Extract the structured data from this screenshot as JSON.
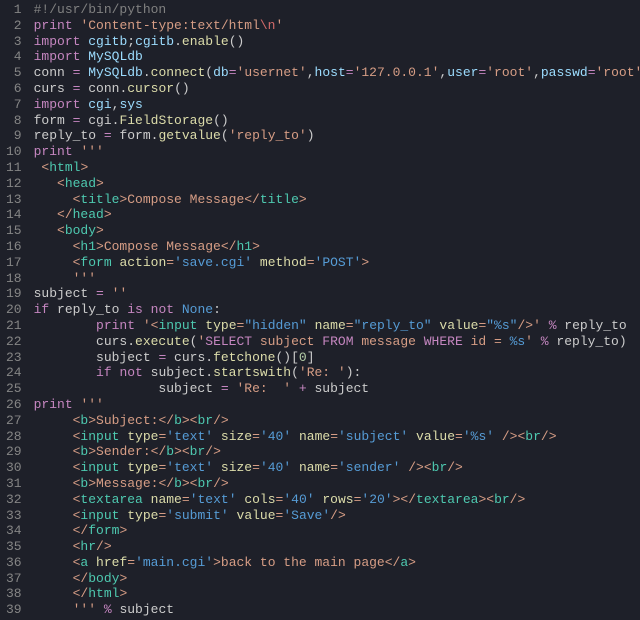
{
  "lines": [
    {
      "n": 1,
      "seg": [
        [
          "#!/usr/bin/python",
          "c-comment"
        ]
      ]
    },
    {
      "n": 2,
      "seg": [
        [
          "print",
          "c-keyword"
        ],
        [
          " ",
          "c-default"
        ],
        [
          "'Content-type:text/html",
          "c-string"
        ],
        [
          "\\n",
          "c-red"
        ],
        [
          "'",
          "c-string"
        ]
      ]
    },
    {
      "n": 3,
      "seg": [
        [
          "import",
          "c-keyword"
        ],
        [
          " ",
          "c-default"
        ],
        [
          "cgitb",
          "c-member"
        ],
        [
          ";",
          "c-default"
        ],
        [
          "cgitb",
          "c-member"
        ],
        [
          ".",
          "c-default"
        ],
        [
          "enable",
          "c-func"
        ],
        [
          "()",
          "c-default"
        ]
      ]
    },
    {
      "n": 4,
      "seg": [
        [
          "import",
          "c-keyword"
        ],
        [
          " ",
          "c-default"
        ],
        [
          "MySQLdb",
          "c-member"
        ]
      ]
    },
    {
      "n": 5,
      "seg": [
        [
          "conn ",
          "c-default"
        ],
        [
          "=",
          "c-keyword"
        ],
        [
          " ",
          "c-default"
        ],
        [
          "MySQLdb",
          "c-member"
        ],
        [
          ".",
          "c-default"
        ],
        [
          "connect",
          "c-func"
        ],
        [
          "(",
          "c-default"
        ],
        [
          "db",
          "c-member"
        ],
        [
          "=",
          "c-keyword"
        ],
        [
          "'usernet'",
          "c-string"
        ],
        [
          ",",
          "c-default"
        ],
        [
          "host",
          "c-member"
        ],
        [
          "=",
          "c-keyword"
        ],
        [
          "'127.0.0.1'",
          "c-string"
        ],
        [
          ",",
          "c-default"
        ],
        [
          "user",
          "c-member"
        ],
        [
          "=",
          "c-keyword"
        ],
        [
          "'root'",
          "c-string"
        ],
        [
          ",",
          "c-default"
        ],
        [
          "passwd",
          "c-member"
        ],
        [
          "=",
          "c-keyword"
        ],
        [
          "'root'",
          "c-string"
        ],
        [
          ")",
          "c-default"
        ]
      ]
    },
    {
      "n": 6,
      "seg": [
        [
          "curs ",
          "c-default"
        ],
        [
          "=",
          "c-keyword"
        ],
        [
          " conn.",
          "c-default"
        ],
        [
          "cursor",
          "c-func"
        ],
        [
          "()",
          "c-default"
        ]
      ]
    },
    {
      "n": 7,
      "seg": [
        [
          "import",
          "c-keyword"
        ],
        [
          " ",
          "c-default"
        ],
        [
          "cgi",
          "c-member"
        ],
        [
          ",",
          "c-default"
        ],
        [
          "sys",
          "c-member"
        ]
      ]
    },
    {
      "n": 8,
      "seg": [
        [
          "form ",
          "c-default"
        ],
        [
          "=",
          "c-keyword"
        ],
        [
          " cgi.",
          "c-default"
        ],
        [
          "FieldStorage",
          "c-func"
        ],
        [
          "()",
          "c-default"
        ]
      ]
    },
    {
      "n": 9,
      "seg": [
        [
          "reply_to ",
          "c-default"
        ],
        [
          "=",
          "c-keyword"
        ],
        [
          " form.",
          "c-default"
        ],
        [
          "getvalue",
          "c-func"
        ],
        [
          "(",
          "c-default"
        ],
        [
          "'reply_to'",
          "c-string"
        ],
        [
          ")",
          "c-default"
        ]
      ]
    },
    {
      "n": 10,
      "seg": [
        [
          "print",
          "c-keyword"
        ],
        [
          " ",
          "c-default"
        ],
        [
          "'''",
          "c-string"
        ]
      ]
    },
    {
      "n": 11,
      "seg": [
        [
          " <",
          "c-string"
        ],
        [
          "html",
          "c-tag"
        ],
        [
          ">",
          "c-string"
        ]
      ]
    },
    {
      "n": 12,
      "seg": [
        [
          "   <",
          "c-string"
        ],
        [
          "head",
          "c-tag"
        ],
        [
          ">",
          "c-string"
        ]
      ]
    },
    {
      "n": 13,
      "seg": [
        [
          "     <",
          "c-string"
        ],
        [
          "title",
          "c-tag"
        ],
        [
          ">Compose Message</",
          "c-string"
        ],
        [
          "title",
          "c-tag"
        ],
        [
          ">",
          "c-string"
        ]
      ]
    },
    {
      "n": 14,
      "seg": [
        [
          "   </",
          "c-string"
        ],
        [
          "head",
          "c-tag"
        ],
        [
          ">",
          "c-string"
        ]
      ]
    },
    {
      "n": 15,
      "seg": [
        [
          "   <",
          "c-string"
        ],
        [
          "body",
          "c-tag"
        ],
        [
          ">",
          "c-string"
        ]
      ]
    },
    {
      "n": 16,
      "seg": [
        [
          "     <",
          "c-string"
        ],
        [
          "h1",
          "c-tag"
        ],
        [
          ">Compose Message</",
          "c-string"
        ],
        [
          "h1",
          "c-tag"
        ],
        [
          ">",
          "c-string"
        ]
      ]
    },
    {
      "n": 17,
      "seg": [
        [
          "     <",
          "c-string"
        ],
        [
          "form",
          "c-tag"
        ],
        [
          " ",
          "c-string"
        ],
        [
          "action",
          "c-builtin"
        ],
        [
          "=",
          "c-string"
        ],
        [
          "'save.cgi'",
          "c-blue"
        ],
        [
          " ",
          "c-string"
        ],
        [
          "method",
          "c-builtin"
        ],
        [
          "=",
          "c-string"
        ],
        [
          "'POST'",
          "c-blue"
        ],
        [
          ">",
          "c-string"
        ]
      ]
    },
    {
      "n": 18,
      "seg": [
        [
          "     '''",
          "c-string"
        ]
      ]
    },
    {
      "n": 19,
      "seg": [
        [
          "subject ",
          "c-default"
        ],
        [
          "=",
          "c-keyword"
        ],
        [
          " ",
          "c-default"
        ],
        [
          "''",
          "c-string"
        ]
      ]
    },
    {
      "n": 20,
      "seg": [
        [
          "if",
          "c-keyword"
        ],
        [
          " reply_to ",
          "c-default"
        ],
        [
          "is",
          "c-keyword"
        ],
        [
          " ",
          "c-default"
        ],
        [
          "not",
          "c-keyword"
        ],
        [
          " ",
          "c-default"
        ],
        [
          "None",
          "c-blue"
        ],
        [
          ":",
          "c-default"
        ]
      ]
    },
    {
      "n": 21,
      "seg": [
        [
          "        ",
          "c-default"
        ],
        [
          "print",
          "c-keyword"
        ],
        [
          " ",
          "c-default"
        ],
        [
          "'<",
          "c-string"
        ],
        [
          "input",
          "c-tag"
        ],
        [
          " ",
          "c-string"
        ],
        [
          "type",
          "c-builtin"
        ],
        [
          "=",
          "c-string"
        ],
        [
          "\"hidden\"",
          "c-blue"
        ],
        [
          " ",
          "c-string"
        ],
        [
          "name",
          "c-builtin"
        ],
        [
          "=",
          "c-string"
        ],
        [
          "\"reply_to\"",
          "c-blue"
        ],
        [
          " ",
          "c-string"
        ],
        [
          "value",
          "c-builtin"
        ],
        [
          "=",
          "c-string"
        ],
        [
          "\"%s\"",
          "c-blue"
        ],
        [
          "/>'",
          "c-string"
        ],
        [
          " ",
          "c-default"
        ],
        [
          "%",
          "c-keyword"
        ],
        [
          " reply_to",
          "c-default"
        ]
      ]
    },
    {
      "n": 22,
      "seg": [
        [
          "        curs.",
          "c-default"
        ],
        [
          "execute",
          "c-func"
        ],
        [
          "(",
          "c-default"
        ],
        [
          "'",
          "c-string"
        ],
        [
          "SELECT",
          "c-keyword"
        ],
        [
          " subject ",
          "c-string"
        ],
        [
          "FROM",
          "c-keyword"
        ],
        [
          " message ",
          "c-string"
        ],
        [
          "WHERE",
          "c-keyword"
        ],
        [
          " id = ",
          "c-string"
        ],
        [
          "%s",
          "c-blue"
        ],
        [
          "'",
          "c-string"
        ],
        [
          " ",
          "c-default"
        ],
        [
          "%",
          "c-keyword"
        ],
        [
          " reply_to)",
          "c-default"
        ]
      ]
    },
    {
      "n": 23,
      "seg": [
        [
          "        subject ",
          "c-default"
        ],
        [
          "=",
          "c-keyword"
        ],
        [
          " curs.",
          "c-default"
        ],
        [
          "fetchone",
          "c-func"
        ],
        [
          "()[",
          "c-default"
        ],
        [
          "0",
          "c-num"
        ],
        [
          "]",
          "c-default"
        ]
      ]
    },
    {
      "n": 24,
      "seg": [
        [
          "        ",
          "c-default"
        ],
        [
          "if",
          "c-keyword"
        ],
        [
          " ",
          "c-default"
        ],
        [
          "not",
          "c-keyword"
        ],
        [
          " subject.",
          "c-default"
        ],
        [
          "startswith",
          "c-func"
        ],
        [
          "(",
          "c-default"
        ],
        [
          "'Re: '",
          "c-string"
        ],
        [
          "):",
          "c-default"
        ]
      ]
    },
    {
      "n": 25,
      "seg": [
        [
          "                subject ",
          "c-default"
        ],
        [
          "=",
          "c-keyword"
        ],
        [
          " ",
          "c-default"
        ],
        [
          "'Re:  '",
          "c-string"
        ],
        [
          " ",
          "c-default"
        ],
        [
          "+",
          "c-keyword"
        ],
        [
          " subject",
          "c-default"
        ]
      ]
    },
    {
      "n": 26,
      "seg": [
        [
          "print",
          "c-keyword"
        ],
        [
          " ",
          "c-default"
        ],
        [
          "'''",
          "c-string"
        ]
      ]
    },
    {
      "n": 27,
      "seg": [
        [
          "     <",
          "c-string"
        ],
        [
          "b",
          "c-tag"
        ],
        [
          ">Subject:</",
          "c-string"
        ],
        [
          "b",
          "c-tag"
        ],
        [
          "><",
          "c-string"
        ],
        [
          "br",
          "c-tag"
        ],
        [
          "/>",
          "c-string"
        ]
      ]
    },
    {
      "n": 28,
      "seg": [
        [
          "     <",
          "c-string"
        ],
        [
          "input",
          "c-tag"
        ],
        [
          " ",
          "c-string"
        ],
        [
          "type",
          "c-builtin"
        ],
        [
          "=",
          "c-string"
        ],
        [
          "'text'",
          "c-blue"
        ],
        [
          " ",
          "c-string"
        ],
        [
          "size",
          "c-builtin"
        ],
        [
          "=",
          "c-string"
        ],
        [
          "'40'",
          "c-blue"
        ],
        [
          " ",
          "c-string"
        ],
        [
          "name",
          "c-builtin"
        ],
        [
          "=",
          "c-string"
        ],
        [
          "'subject'",
          "c-blue"
        ],
        [
          " ",
          "c-string"
        ],
        [
          "value",
          "c-builtin"
        ],
        [
          "=",
          "c-string"
        ],
        [
          "'%s'",
          "c-blue"
        ],
        [
          " /><",
          "c-string"
        ],
        [
          "br",
          "c-tag"
        ],
        [
          "/>",
          "c-string"
        ]
      ]
    },
    {
      "n": 29,
      "seg": [
        [
          "     <",
          "c-string"
        ],
        [
          "b",
          "c-tag"
        ],
        [
          ">Sender:</",
          "c-string"
        ],
        [
          "b",
          "c-tag"
        ],
        [
          "><",
          "c-string"
        ],
        [
          "br",
          "c-tag"
        ],
        [
          "/>",
          "c-string"
        ]
      ]
    },
    {
      "n": 30,
      "seg": [
        [
          "     <",
          "c-string"
        ],
        [
          "input",
          "c-tag"
        ],
        [
          " ",
          "c-string"
        ],
        [
          "type",
          "c-builtin"
        ],
        [
          "=",
          "c-string"
        ],
        [
          "'text'",
          "c-blue"
        ],
        [
          " ",
          "c-string"
        ],
        [
          "size",
          "c-builtin"
        ],
        [
          "=",
          "c-string"
        ],
        [
          "'40'",
          "c-blue"
        ],
        [
          " ",
          "c-string"
        ],
        [
          "name",
          "c-builtin"
        ],
        [
          "=",
          "c-string"
        ],
        [
          "'sender'",
          "c-blue"
        ],
        [
          " /><",
          "c-string"
        ],
        [
          "br",
          "c-tag"
        ],
        [
          "/>",
          "c-string"
        ]
      ]
    },
    {
      "n": 31,
      "seg": [
        [
          "     <",
          "c-string"
        ],
        [
          "b",
          "c-tag"
        ],
        [
          ">Message:</",
          "c-string"
        ],
        [
          "b",
          "c-tag"
        ],
        [
          "><",
          "c-string"
        ],
        [
          "br",
          "c-tag"
        ],
        [
          "/>",
          "c-string"
        ]
      ]
    },
    {
      "n": 32,
      "seg": [
        [
          "     <",
          "c-string"
        ],
        [
          "textarea",
          "c-tag"
        ],
        [
          " ",
          "c-string"
        ],
        [
          "name",
          "c-builtin"
        ],
        [
          "=",
          "c-string"
        ],
        [
          "'text'",
          "c-blue"
        ],
        [
          " ",
          "c-string"
        ],
        [
          "cols",
          "c-builtin"
        ],
        [
          "=",
          "c-string"
        ],
        [
          "'40'",
          "c-blue"
        ],
        [
          " ",
          "c-string"
        ],
        [
          "rows",
          "c-builtin"
        ],
        [
          "=",
          "c-string"
        ],
        [
          "'20'",
          "c-blue"
        ],
        [
          "></",
          "c-string"
        ],
        [
          "textarea",
          "c-tag"
        ],
        [
          "><",
          "c-string"
        ],
        [
          "br",
          "c-tag"
        ],
        [
          "/>",
          "c-string"
        ]
      ]
    },
    {
      "n": 33,
      "seg": [
        [
          "     <",
          "c-string"
        ],
        [
          "input",
          "c-tag"
        ],
        [
          " ",
          "c-string"
        ],
        [
          "type",
          "c-builtin"
        ],
        [
          "=",
          "c-string"
        ],
        [
          "'submit'",
          "c-blue"
        ],
        [
          " ",
          "c-string"
        ],
        [
          "value",
          "c-builtin"
        ],
        [
          "=",
          "c-string"
        ],
        [
          "'Save'",
          "c-blue"
        ],
        [
          "/>",
          "c-string"
        ]
      ]
    },
    {
      "n": 34,
      "seg": [
        [
          "     </",
          "c-string"
        ],
        [
          "form",
          "c-tag"
        ],
        [
          ">",
          "c-string"
        ]
      ]
    },
    {
      "n": 35,
      "seg": [
        [
          "     <",
          "c-string"
        ],
        [
          "hr",
          "c-tag"
        ],
        [
          "/>",
          "c-string"
        ]
      ]
    },
    {
      "n": 36,
      "seg": [
        [
          "     <",
          "c-string"
        ],
        [
          "a",
          "c-tag"
        ],
        [
          " ",
          "c-string"
        ],
        [
          "href",
          "c-builtin"
        ],
        [
          "=",
          "c-string"
        ],
        [
          "'main.cgi'",
          "c-blue"
        ],
        [
          ">back to the main page</",
          "c-string"
        ],
        [
          "a",
          "c-tag"
        ],
        [
          ">",
          "c-string"
        ]
      ]
    },
    {
      "n": 37,
      "seg": [
        [
          "     </",
          "c-string"
        ],
        [
          "body",
          "c-tag"
        ],
        [
          ">",
          "c-string"
        ]
      ]
    },
    {
      "n": 38,
      "seg": [
        [
          "     </",
          "c-string"
        ],
        [
          "html",
          "c-tag"
        ],
        [
          ">",
          "c-string"
        ]
      ]
    },
    {
      "n": 39,
      "seg": [
        [
          "     '''",
          "c-string"
        ],
        [
          " ",
          "c-default"
        ],
        [
          "%",
          "c-keyword"
        ],
        [
          " subject",
          "c-default"
        ]
      ]
    }
  ]
}
